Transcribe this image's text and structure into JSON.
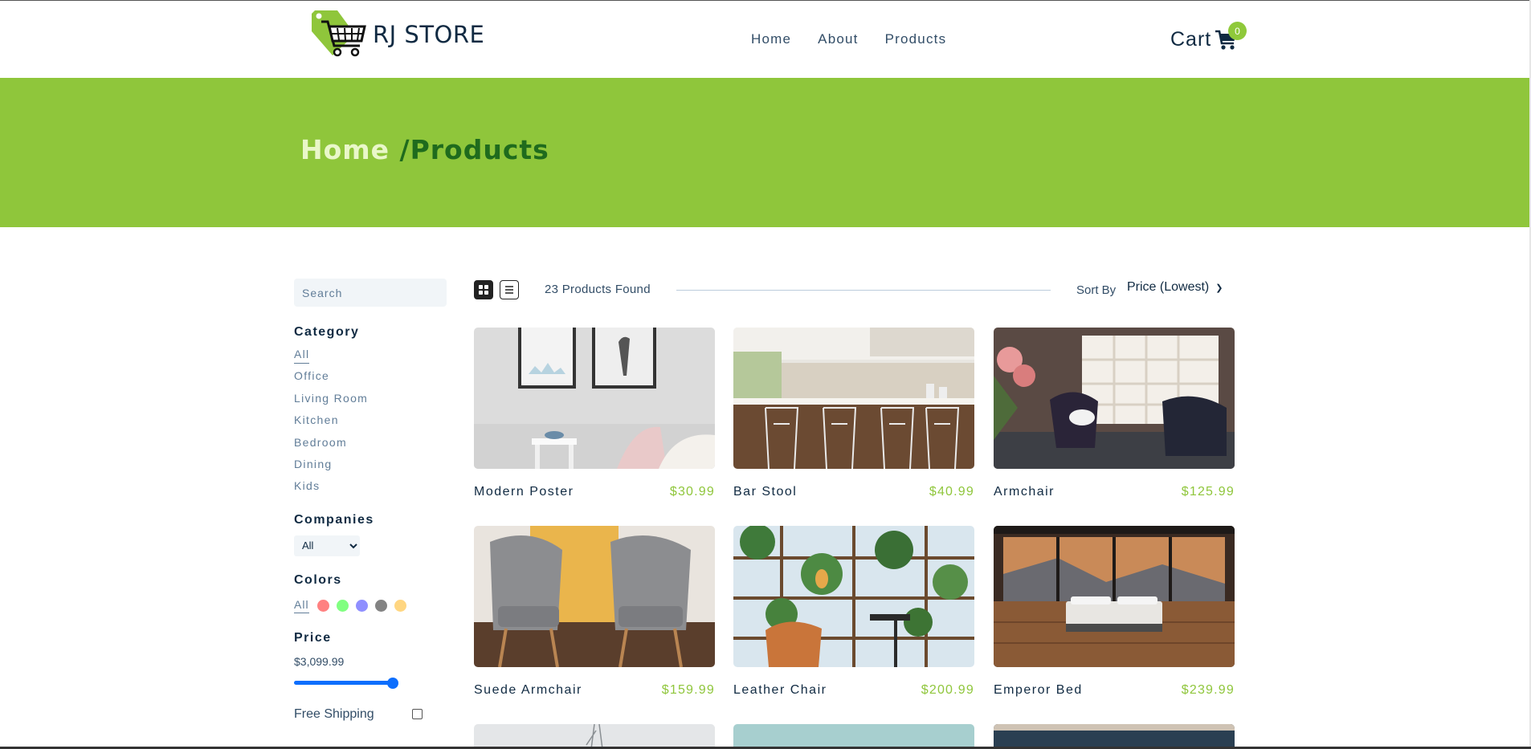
{
  "nav": {
    "brand": "RJ STORE",
    "links": [
      "Home",
      "About",
      "Products"
    ],
    "cart_label": "Cart",
    "cart_count": "0"
  },
  "hero": {
    "crumb_home": "Home ",
    "crumb_current": "/Products"
  },
  "filters": {
    "search_placeholder": "Search",
    "category_heading": "Category",
    "categories": [
      "All",
      "Office",
      "Living Room",
      "Kitchen",
      "Bedroom",
      "Dining",
      "Kids"
    ],
    "companies_heading": "Companies",
    "company_selected": "All",
    "colors_heading": "Colors",
    "colors_all": "All",
    "colors": [
      "#ff6b6b",
      "#6bff6b",
      "#7b7bff",
      "#6d6d6d",
      "#ffcf6b"
    ],
    "price_heading": "Price",
    "price_value": "$3,099.99",
    "price_fraction": 1.0,
    "free_shipping_label": "Free Shipping",
    "free_shipping_checked": false
  },
  "toolbar": {
    "found_text": "23 Products Found",
    "sort_label": "Sort By",
    "sort_selected": "Price (Lowest)",
    "view_mode": "grid"
  },
  "products": [
    {
      "name": "Modern Poster",
      "price": "$30.99"
    },
    {
      "name": "Bar Stool",
      "price": "$40.99"
    },
    {
      "name": "Armchair",
      "price": "$125.99"
    },
    {
      "name": "Suede Armchair",
      "price": "$159.99"
    },
    {
      "name": "Leather Chair",
      "price": "$200.99"
    },
    {
      "name": "Emperor Bed",
      "price": "$239.99"
    }
  ]
}
